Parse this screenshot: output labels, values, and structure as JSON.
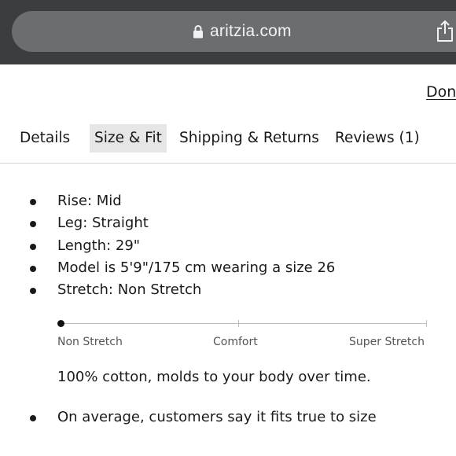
{
  "browser": {
    "url": "aritzia.com",
    "icons": {
      "lock": "lock-icon",
      "share": "share-icon"
    }
  },
  "header": {
    "done_label": "Done"
  },
  "tabs": [
    {
      "label": "Details",
      "active": false
    },
    {
      "label": "Size & Fit",
      "active": true
    },
    {
      "label": "Shipping & Returns",
      "active": false
    },
    {
      "label": "Reviews (1)",
      "active": false
    }
  ],
  "size_fit": {
    "bullets": [
      "Rise: Mid",
      "Leg: Straight",
      "Length: 29\"",
      "Model is 5'9\"/175 cm wearing a size 26",
      "Stretch: Non Stretch"
    ],
    "stretch_scale": {
      "labels": [
        "Non Stretch",
        "Comfort",
        "Super Stretch"
      ],
      "selected": "Non Stretch"
    },
    "fabric": "100% cotton, molds to your body over time.",
    "fit_note": "On average, customers say it fits true to size"
  },
  "colors": {
    "browser_bg": "#3b3d3f",
    "url_pill": "#6b6e70",
    "active_tab_bg": "#e6e6e6",
    "text": "#1a1a1a"
  }
}
